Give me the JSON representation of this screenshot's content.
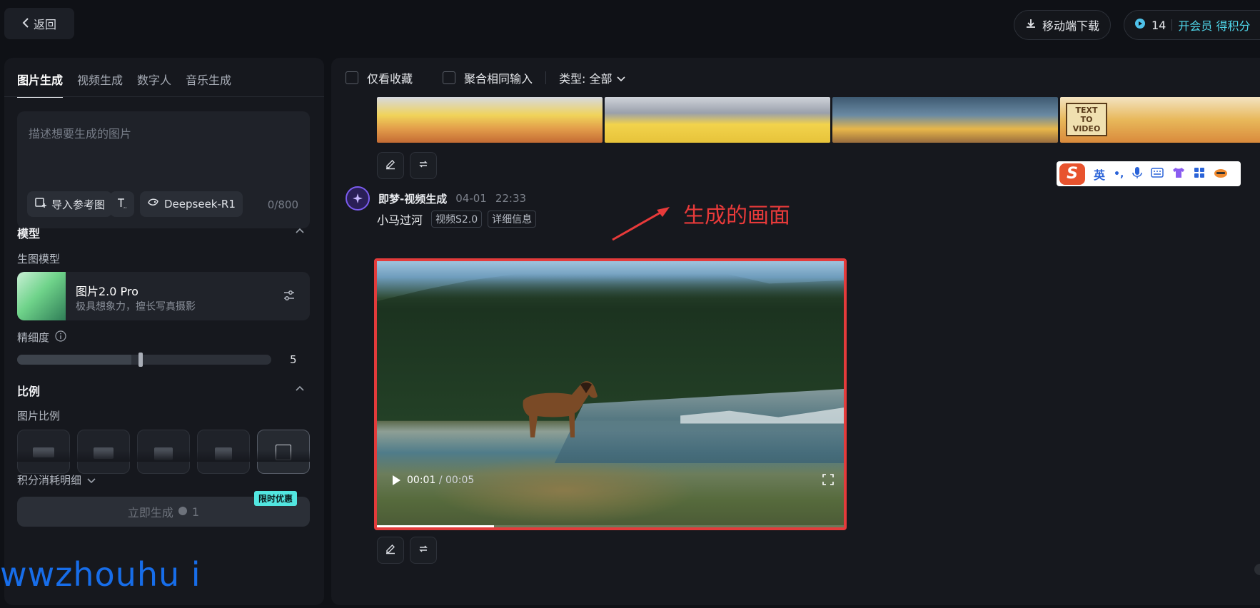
{
  "topbar": {
    "back_label": "返回",
    "mobile_download": "移动端下载",
    "credits_count": "14",
    "vip_label": "开会员 得积分"
  },
  "left": {
    "tabs": [
      "图片生成",
      "视频生成",
      "数字人",
      "音乐生成"
    ],
    "prompt_placeholder": "描述想要生成的图片",
    "import_ref": "导入参考图",
    "deepseek": "Deepseek-R1",
    "counter": "0/800",
    "model_section": "模型",
    "model_sub": "生图模型",
    "model_name": "图片2.0 Pro",
    "model_desc": "极具想象力，擅长写真摄影",
    "detail_label": "精细度",
    "detail_value": "5",
    "detail_fraction": 0.45,
    "ratio_section": "比例",
    "ratio_sub": "图片比例",
    "cost_label": "积分消耗明细",
    "generate_label": "立即生成",
    "generate_cost": "1",
    "promo": "限时优惠"
  },
  "right": {
    "filter_fav": "仅看收藏",
    "filter_merge": "聚合相同输入",
    "filter_type": "类型: 全部",
    "thumb_badge": "TEXT TO VIDEO",
    "task_name": "即梦-视频生成",
    "task_date": "04-01",
    "task_time": "22:33",
    "prompt": "小马过河",
    "tag_model": "视频S2.0",
    "tag_detail": "详细信息",
    "video_current": "00:01",
    "video_total": "/ 00:05",
    "video_progress": 0.25,
    "annotation": "生成的画面"
  },
  "ime": {
    "lang": "英",
    "punct": "•,"
  },
  "watermark": "wwzhouhu i"
}
